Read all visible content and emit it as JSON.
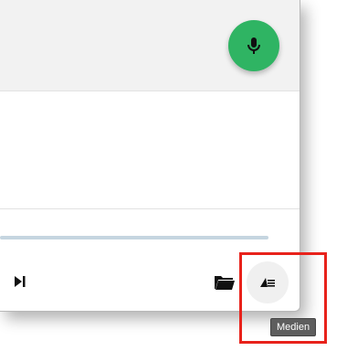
{
  "icons": {
    "mic": "mic-icon",
    "next": "skip-next-icon",
    "folder": "folder-icon",
    "media": "media-list-icon"
  },
  "tooltip": {
    "label": "Medien"
  },
  "colors": {
    "fab": "#2fb463",
    "progress_track": "#c5d5e0",
    "highlight": "#e8221b"
  }
}
